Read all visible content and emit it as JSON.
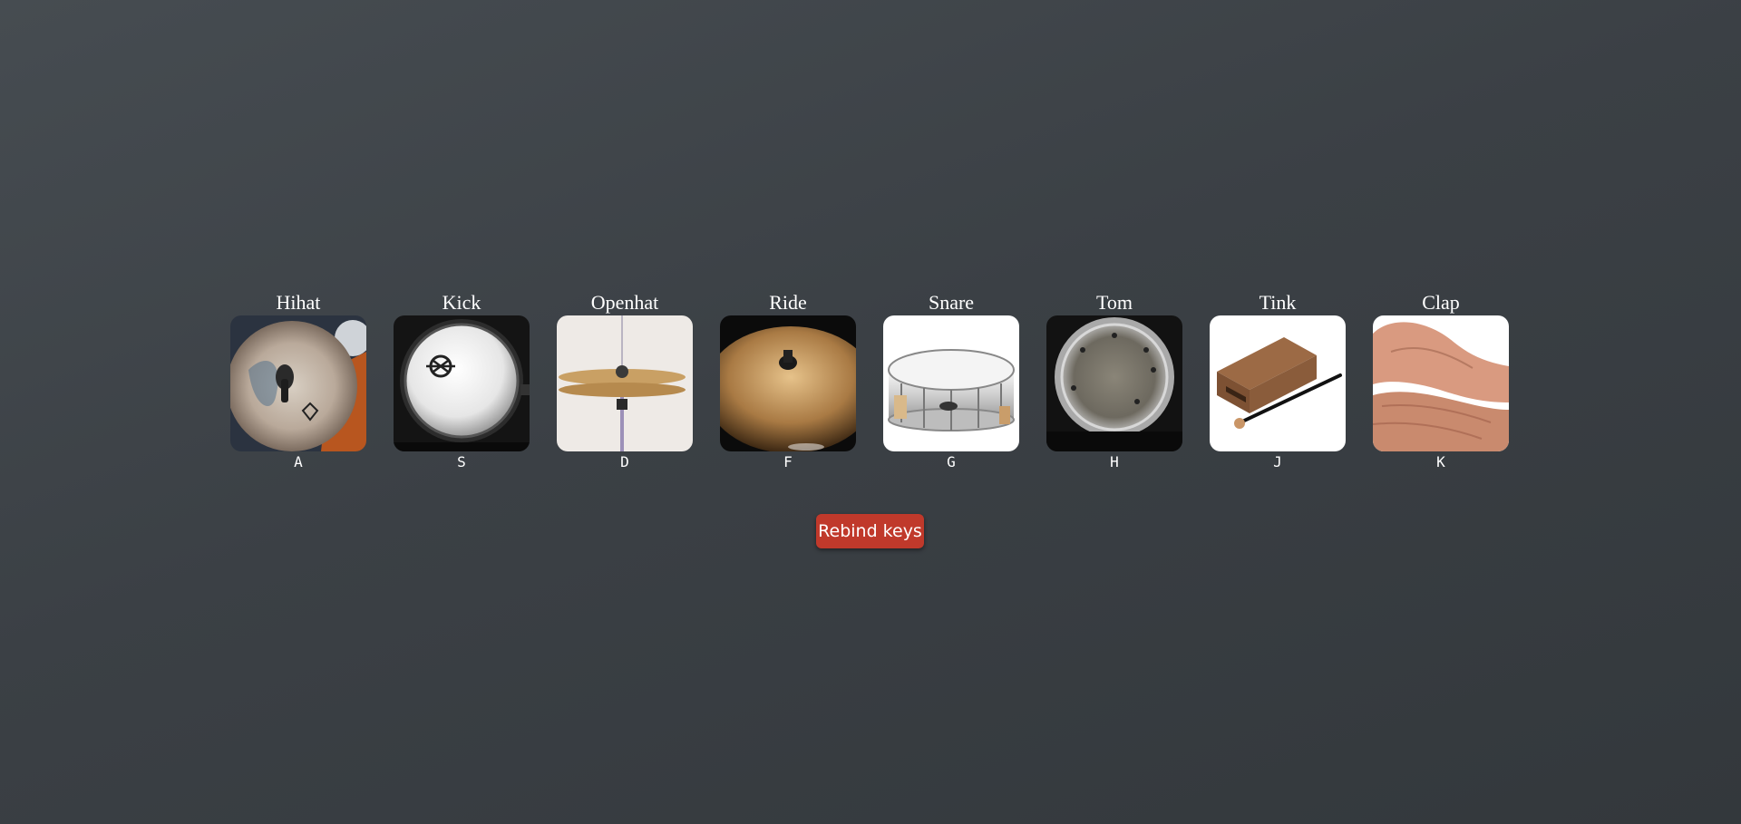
{
  "pads": [
    {
      "name": "Hihat",
      "key": "A",
      "icon": "hihat-cymbal-image"
    },
    {
      "name": "Kick",
      "key": "S",
      "icon": "kick-drum-image"
    },
    {
      "name": "Openhat",
      "key": "D",
      "icon": "openhat-cymbal-image"
    },
    {
      "name": "Ride",
      "key": "F",
      "icon": "ride-cymbal-image"
    },
    {
      "name": "Snare",
      "key": "G",
      "icon": "snare-drum-image"
    },
    {
      "name": "Tom",
      "key": "H",
      "icon": "tom-drum-image"
    },
    {
      "name": "Tink",
      "key": "J",
      "icon": "wood-block-image"
    },
    {
      "name": "Clap",
      "key": "K",
      "icon": "clapping-hands-image"
    }
  ],
  "controls": {
    "rebind_label": "Rebind keys"
  },
  "colors": {
    "background": "#3b4045",
    "button": "#c0392b",
    "text": "#ffffff"
  }
}
